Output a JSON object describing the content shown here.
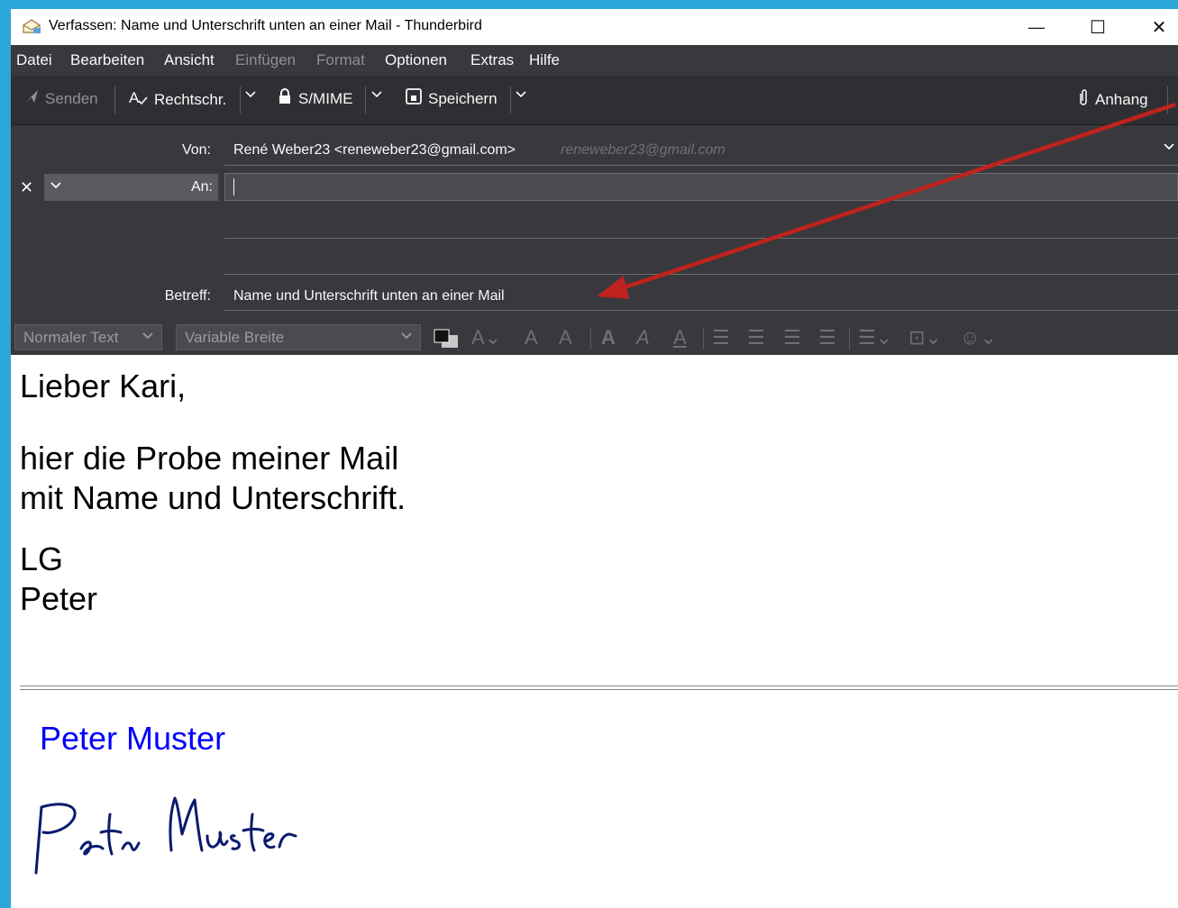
{
  "window": {
    "title": "Verfassen: Name und Unterschrift unten an einer Mail - Thunderbird",
    "app_icon": "compose-envelope-icon",
    "minimize_glyph": "—",
    "maximize_glyph": "☐",
    "close_glyph": "✕"
  },
  "menubar": {
    "items": [
      {
        "label": "Datei",
        "enabled": true
      },
      {
        "label": "Bearbeiten",
        "enabled": true
      },
      {
        "label": "Ansicht",
        "enabled": true
      },
      {
        "label": "Einfügen",
        "enabled": false
      },
      {
        "label": "Format",
        "enabled": false
      },
      {
        "label": "Optionen",
        "enabled": true
      },
      {
        "label": "Extras",
        "enabled": true
      },
      {
        "label": "Hilfe",
        "enabled": true
      }
    ]
  },
  "toolbar": {
    "send_label": "Senden",
    "spell_label": "Rechtschr.",
    "smime_label": "S/MIME",
    "save_label": "Speichern",
    "attach_label": "Anhang"
  },
  "headers": {
    "from_label": "Von:",
    "from_value": "René Weber23 <reneweber23@gmail.com>",
    "from_hint": "reneweber23@gmail.com",
    "to_label": "An:",
    "to_value": "",
    "subject_label": "Betreff:",
    "subject_value": "Name und Unterschrift unten an einer Mail"
  },
  "formatbar": {
    "paragraph_style": "Normaler Text",
    "font": "Variable Breite"
  },
  "message": {
    "greeting": "Lieber Kari,",
    "paragraph": "hier die Probe meiner Mail\nmit Name und Unterschrift.",
    "closing": "LG\nPeter",
    "signature_name": "Peter Muster",
    "signature_handwritten": "Peter Muster"
  },
  "colors": {
    "annotation_arrow": "#c0221d",
    "signature_text": "#0000ff",
    "dark_chrome": "#38383d",
    "desktop": "#2aa6d8"
  }
}
